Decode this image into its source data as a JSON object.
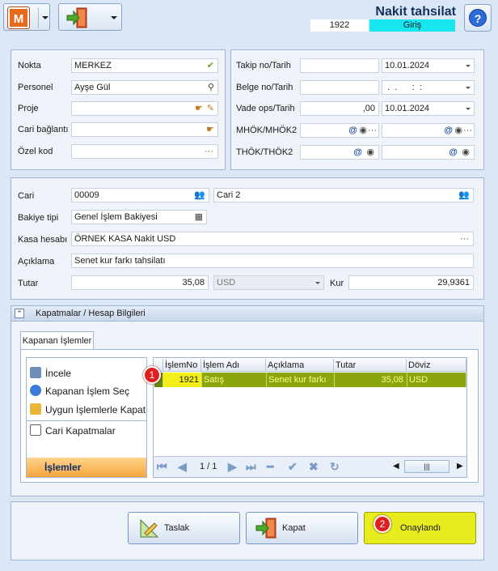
{
  "toolbar": {
    "m_label": "M"
  },
  "header": {
    "title": "Nakit tahsilat",
    "code": "1922",
    "mode": "Giriş",
    "help": "?"
  },
  "left_panel": {
    "nokta": {
      "label": "Nokta",
      "value": "MERKEZ"
    },
    "personel": {
      "label": "Personel",
      "value": "Ayşe Gül"
    },
    "proje": {
      "label": "Proje",
      "value": ""
    },
    "cari_baglanti": {
      "label": "Cari bağlantı",
      "value": ""
    },
    "ozel_kod": {
      "label": "Özel kod",
      "value": ""
    }
  },
  "right_panel": {
    "takip": {
      "label": "Takip no/Tarih",
      "value": "",
      "date": "10.01.2024"
    },
    "belge": {
      "label": "Belge no/Tarih",
      "value": "",
      "date": " .  .      :  :"
    },
    "vade": {
      "label": "Vade ops/Tarih",
      "value": ",00",
      "date": "10.01.2024"
    },
    "mhok": {
      "label": "MHÖK/MHÖK2"
    },
    "thok": {
      "label": "THÖK/THÖK2"
    }
  },
  "cari_panel": {
    "cari": {
      "label": "Cari",
      "code": "00009",
      "name": "Cari 2"
    },
    "bakiye": {
      "label": "Bakiye tipi",
      "value": "Genel İşlem Bakiyesi"
    },
    "kasa": {
      "label": "Kasa hesabı",
      "value": "ÖRNEK KASA Nakit USD"
    },
    "aciklama": {
      "label": "Açıklama",
      "value": "Senet kur farkı tahsilatı"
    },
    "tutar": {
      "label": "Tutar",
      "value": "35,08",
      "currency": "USD",
      "kur_label": "Kur",
      "kur": "29,9361"
    }
  },
  "section": {
    "title": "Kapatmalar / Hesap Bilgileri",
    "tab": "Kapanan İşlemler"
  },
  "side_menu": {
    "items": [
      "İncele",
      "Kapanan İşlem Seç",
      "Uygun İşlemlerle Kapat",
      "Cari Kapatmalar"
    ],
    "footer": "İşlemler"
  },
  "grid": {
    "columns": [
      "İşlemNo",
      "İşlem Adı",
      "Açıklama",
      "Tutar",
      "Döviz"
    ],
    "rows": [
      {
        "no": "1921",
        "name": "Satış",
        "desc": "Senet kur farkı",
        "tutar": "35,08",
        "doviz": "USD"
      }
    ],
    "page": "1 / 1"
  },
  "badges": {
    "one": "1",
    "two": "2"
  },
  "buttons": {
    "taslak": "Taslak",
    "kapat": "Kapat",
    "onay": "Onaylandı"
  },
  "colors": {
    "selected_row": "#8aa60c",
    "giris_bg": "#16e6f0",
    "onay_bg": "#e6ec1e"
  }
}
